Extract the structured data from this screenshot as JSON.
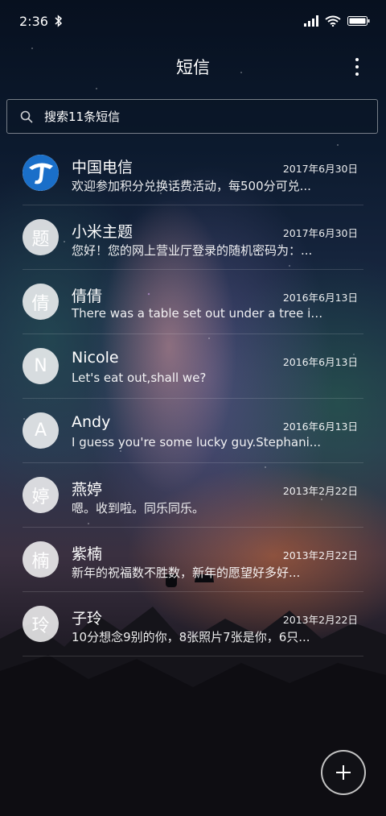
{
  "status_bar": {
    "time": "2:36",
    "icons": [
      "bluetooth-icon",
      "signal-icon",
      "wifi-icon",
      "battery-icon"
    ]
  },
  "header": {
    "title": "短信",
    "more_icon": "more-vertical-icon"
  },
  "search": {
    "placeholder": "搜索11条短信",
    "icon": "search-icon"
  },
  "conversations": [
    {
      "avatar_text": "",
      "avatar_type": "china-telecom-logo",
      "name": "中国电信",
      "date": "2017年6月30日",
      "preview": "欢迎参加积分兑换话费活动，每500分可兑..."
    },
    {
      "avatar_text": "题",
      "name": "小米主题",
      "date": "2017年6月30日",
      "preview": "您好！您的网上营业厅登录的随机密码为：..."
    },
    {
      "avatar_text": "倩",
      "name": "倩倩",
      "date": "2016年6月13日",
      "preview": "There was a table set out under a tree in..."
    },
    {
      "avatar_text": "N",
      "name": "Nicole",
      "date": "2016年6月13日",
      "preview": "Let's eat out,shall we?"
    },
    {
      "avatar_text": "A",
      "name": "Andy",
      "date": "2016年6月13日",
      "preview": "I guess you're some lucky guy.Stephani..."
    },
    {
      "avatar_text": "婷",
      "name": "燕婷",
      "date": "2013年2月22日",
      "preview": "嗯。收到啦。同乐同乐。"
    },
    {
      "avatar_text": "楠",
      "name": "紫楠",
      "date": "2013年2月22日",
      "preview": "新年的祝福数不胜数，新年的愿望好多好..."
    },
    {
      "avatar_text": "玲",
      "name": "子玲",
      "date": "2013年2月22日",
      "preview": "10分想念9别的你，8张照片7张是你，6只..."
    }
  ],
  "fab": {
    "icon": "plus-icon"
  }
}
